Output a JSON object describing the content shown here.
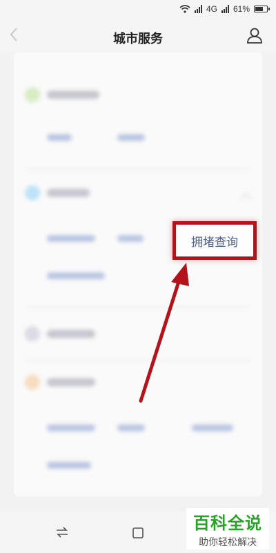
{
  "status_bar": {
    "left_text": "",
    "network": "4G",
    "battery": "61%"
  },
  "header": {
    "title": "城市服务",
    "back_icon": "chevron-left-icon",
    "user_icon": "user-icon"
  },
  "highlight": {
    "label": "拥堵查询",
    "border_color": "#b3131b",
    "text_color": "#4b5f8a"
  },
  "arrow": {
    "color": "#b3131b"
  },
  "nav_bar": {
    "back_icon": "swap-icon",
    "home_icon": "square-icon"
  },
  "watermark": {
    "title": "百科全说",
    "subtitle": "助你轻松解决",
    "color": "#27a327"
  }
}
